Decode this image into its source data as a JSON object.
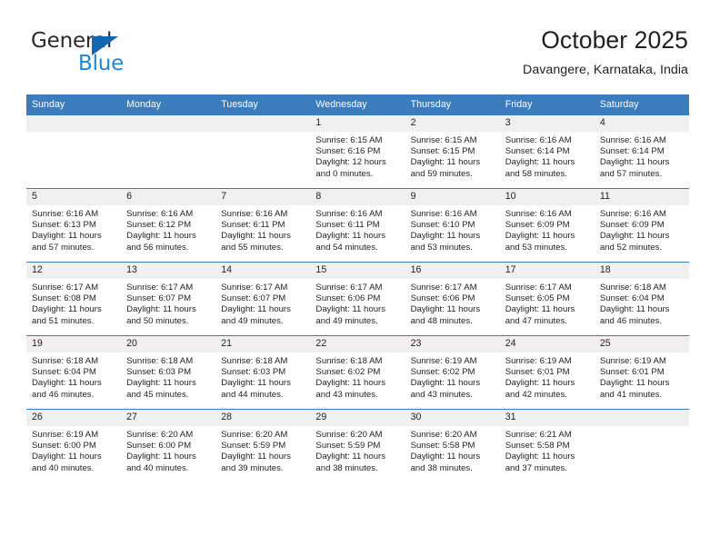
{
  "brand": {
    "name_top": "General",
    "name_bottom": "Blue",
    "accent_color": "#2186d2",
    "triangle_color": "#1367b0"
  },
  "header": {
    "title": "October 2025",
    "subtitle": "Davangere, Karnataka, India"
  },
  "calendar": {
    "header_bg": "#3a7cbe",
    "daynum_bg": "#f0f0f0",
    "weekday_headers": [
      "Sunday",
      "Monday",
      "Tuesday",
      "Wednesday",
      "Thursday",
      "Friday",
      "Saturday"
    ],
    "weeks": [
      [
        {
          "day": "",
          "empty": true
        },
        {
          "day": "",
          "empty": true
        },
        {
          "day": "",
          "empty": true
        },
        {
          "day": "1",
          "sunrise": "Sunrise: 6:15 AM",
          "sunset": "Sunset: 6:16 PM",
          "daylight": "Daylight: 12 hours and 0 minutes."
        },
        {
          "day": "2",
          "sunrise": "Sunrise: 6:15 AM",
          "sunset": "Sunset: 6:15 PM",
          "daylight": "Daylight: 11 hours and 59 minutes."
        },
        {
          "day": "3",
          "sunrise": "Sunrise: 6:16 AM",
          "sunset": "Sunset: 6:14 PM",
          "daylight": "Daylight: 11 hours and 58 minutes."
        },
        {
          "day": "4",
          "sunrise": "Sunrise: 6:16 AM",
          "sunset": "Sunset: 6:14 PM",
          "daylight": "Daylight: 11 hours and 57 minutes."
        }
      ],
      [
        {
          "day": "5",
          "sunrise": "Sunrise: 6:16 AM",
          "sunset": "Sunset: 6:13 PM",
          "daylight": "Daylight: 11 hours and 57 minutes."
        },
        {
          "day": "6",
          "sunrise": "Sunrise: 6:16 AM",
          "sunset": "Sunset: 6:12 PM",
          "daylight": "Daylight: 11 hours and 56 minutes."
        },
        {
          "day": "7",
          "sunrise": "Sunrise: 6:16 AM",
          "sunset": "Sunset: 6:11 PM",
          "daylight": "Daylight: 11 hours and 55 minutes."
        },
        {
          "day": "8",
          "sunrise": "Sunrise: 6:16 AM",
          "sunset": "Sunset: 6:11 PM",
          "daylight": "Daylight: 11 hours and 54 minutes."
        },
        {
          "day": "9",
          "sunrise": "Sunrise: 6:16 AM",
          "sunset": "Sunset: 6:10 PM",
          "daylight": "Daylight: 11 hours and 53 minutes."
        },
        {
          "day": "10",
          "sunrise": "Sunrise: 6:16 AM",
          "sunset": "Sunset: 6:09 PM",
          "daylight": "Daylight: 11 hours and 53 minutes."
        },
        {
          "day": "11",
          "sunrise": "Sunrise: 6:16 AM",
          "sunset": "Sunset: 6:09 PM",
          "daylight": "Daylight: 11 hours and 52 minutes."
        }
      ],
      [
        {
          "day": "12",
          "sunrise": "Sunrise: 6:17 AM",
          "sunset": "Sunset: 6:08 PM",
          "daylight": "Daylight: 11 hours and 51 minutes."
        },
        {
          "day": "13",
          "sunrise": "Sunrise: 6:17 AM",
          "sunset": "Sunset: 6:07 PM",
          "daylight": "Daylight: 11 hours and 50 minutes."
        },
        {
          "day": "14",
          "sunrise": "Sunrise: 6:17 AM",
          "sunset": "Sunset: 6:07 PM",
          "daylight": "Daylight: 11 hours and 49 minutes."
        },
        {
          "day": "15",
          "sunrise": "Sunrise: 6:17 AM",
          "sunset": "Sunset: 6:06 PM",
          "daylight": "Daylight: 11 hours and 49 minutes."
        },
        {
          "day": "16",
          "sunrise": "Sunrise: 6:17 AM",
          "sunset": "Sunset: 6:06 PM",
          "daylight": "Daylight: 11 hours and 48 minutes."
        },
        {
          "day": "17",
          "sunrise": "Sunrise: 6:17 AM",
          "sunset": "Sunset: 6:05 PM",
          "daylight": "Daylight: 11 hours and 47 minutes."
        },
        {
          "day": "18",
          "sunrise": "Sunrise: 6:18 AM",
          "sunset": "Sunset: 6:04 PM",
          "daylight": "Daylight: 11 hours and 46 minutes."
        }
      ],
      [
        {
          "day": "19",
          "sunrise": "Sunrise: 6:18 AM",
          "sunset": "Sunset: 6:04 PM",
          "daylight": "Daylight: 11 hours and 46 minutes."
        },
        {
          "day": "20",
          "sunrise": "Sunrise: 6:18 AM",
          "sunset": "Sunset: 6:03 PM",
          "daylight": "Daylight: 11 hours and 45 minutes."
        },
        {
          "day": "21",
          "sunrise": "Sunrise: 6:18 AM",
          "sunset": "Sunset: 6:03 PM",
          "daylight": "Daylight: 11 hours and 44 minutes."
        },
        {
          "day": "22",
          "sunrise": "Sunrise: 6:18 AM",
          "sunset": "Sunset: 6:02 PM",
          "daylight": "Daylight: 11 hours and 43 minutes."
        },
        {
          "day": "23",
          "sunrise": "Sunrise: 6:19 AM",
          "sunset": "Sunset: 6:02 PM",
          "daylight": "Daylight: 11 hours and 43 minutes."
        },
        {
          "day": "24",
          "sunrise": "Sunrise: 6:19 AM",
          "sunset": "Sunset: 6:01 PM",
          "daylight": "Daylight: 11 hours and 42 minutes."
        },
        {
          "day": "25",
          "sunrise": "Sunrise: 6:19 AM",
          "sunset": "Sunset: 6:01 PM",
          "daylight": "Daylight: 11 hours and 41 minutes."
        }
      ],
      [
        {
          "day": "26",
          "sunrise": "Sunrise: 6:19 AM",
          "sunset": "Sunset: 6:00 PM",
          "daylight": "Daylight: 11 hours and 40 minutes."
        },
        {
          "day": "27",
          "sunrise": "Sunrise: 6:20 AM",
          "sunset": "Sunset: 6:00 PM",
          "daylight": "Daylight: 11 hours and 40 minutes."
        },
        {
          "day": "28",
          "sunrise": "Sunrise: 6:20 AM",
          "sunset": "Sunset: 5:59 PM",
          "daylight": "Daylight: 11 hours and 39 minutes."
        },
        {
          "day": "29",
          "sunrise": "Sunrise: 6:20 AM",
          "sunset": "Sunset: 5:59 PM",
          "daylight": "Daylight: 11 hours and 38 minutes."
        },
        {
          "day": "30",
          "sunrise": "Sunrise: 6:20 AM",
          "sunset": "Sunset: 5:58 PM",
          "daylight": "Daylight: 11 hours and 38 minutes."
        },
        {
          "day": "31",
          "sunrise": "Sunrise: 6:21 AM",
          "sunset": "Sunset: 5:58 PM",
          "daylight": "Daylight: 11 hours and 37 minutes."
        },
        {
          "day": "",
          "empty": true
        }
      ]
    ]
  }
}
